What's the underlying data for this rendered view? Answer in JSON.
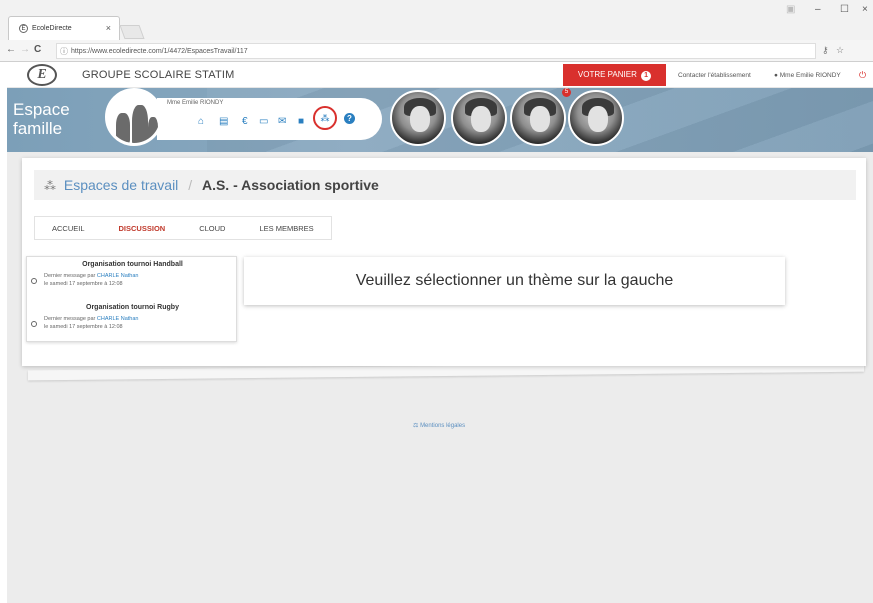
{
  "browser": {
    "tab_title": "EcoleDirecte",
    "tab_close": "×",
    "url": "https://www.ecoledirecte.com/1/4472/EspacesTravail/117",
    "nav_back": "←",
    "nav_forward": "→",
    "nav_reload": "C",
    "window_min": "–",
    "window_max": "☐",
    "window_close": "×"
  },
  "site_header": {
    "school_name": "GROUPE SCOLAIRE STATIM",
    "basket_label": "VOTRE PANIER",
    "basket_count": "1",
    "contact_label": "Contacter l'établissement",
    "user_name": "Mme Emilie RIONDY"
  },
  "banner": {
    "title_line1": "Espace",
    "title_line2": "famille",
    "profile_name": "Mme Emilie RIONDY",
    "kid_badge": "5"
  },
  "breadcrumb": {
    "root": "Espaces de travail",
    "separator": "/",
    "current": "A.S. - Association sportive"
  },
  "tabs": [
    {
      "label": "ACCUEIL"
    },
    {
      "label": "DISCUSSION"
    },
    {
      "label": "CLOUD"
    },
    {
      "label": "LES MEMBRES"
    }
  ],
  "discussions": [
    {
      "title": "Organisation tournoi Handball",
      "last_message_prefix": "Dernier message par ",
      "author": "CHARLE Nathan",
      "date": "le samedi 17 septembre à 12:08"
    },
    {
      "title": "Organisation tournoi Rugby",
      "last_message_prefix": "Dernier message par ",
      "author": "CHARLE Nathan",
      "date": "le samedi 17 septembre à 12:08"
    }
  ],
  "main_message": "Veuillez sélectionner un thème sur la gauche",
  "footer": {
    "legal": "Mentions légales"
  },
  "colors": {
    "accent_red": "#d9302d",
    "link_blue": "#2a7fc0",
    "banner": "#7c9fb8"
  }
}
